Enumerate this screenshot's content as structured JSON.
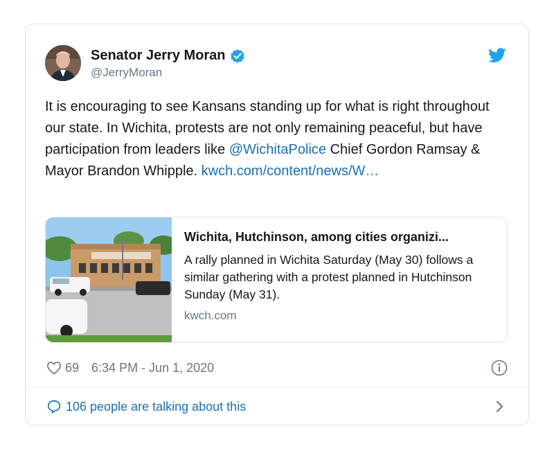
{
  "author": {
    "display_name": "Senator Jerry Moran",
    "handle": "@JerryMoran"
  },
  "tweet": {
    "text_part1": "It is encouraging to see Kansans standing up for what is right throughout our state. In Wichita, protests are not only remaining peaceful, but have participation from leaders like ",
    "mention": "@WichitaPolice",
    "text_part2": " Chief Gordon Ramsay & Mayor Brandon Whipple. ",
    "link": "kwch.com/content/news/W…"
  },
  "link_card": {
    "title": "Wichita, Hutchinson, among cities organizi...",
    "description": "A rally planned in Wichita Saturday (May 30) follows a similar gathering with a protest planned in Hutchinson Sunday (May 31).",
    "domain": "kwch.com"
  },
  "meta": {
    "likes": "69",
    "timestamp": "6:34 PM - Jun 1, 2020"
  },
  "footer": {
    "talking": "106 people are talking about this"
  },
  "colors": {
    "link": "#1b6fb3",
    "twitter_blue": "#1da1f2",
    "secondary_text": "#657786"
  }
}
